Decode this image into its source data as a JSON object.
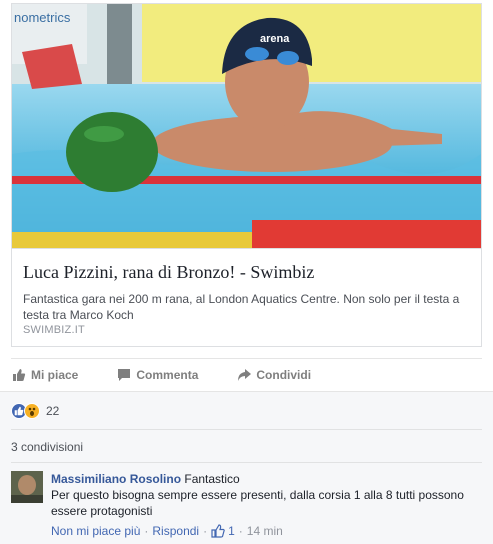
{
  "link_card": {
    "title": "Luca Pizzini, rana di Bronzo! - Swimbiz",
    "description": "Fantastica gara nei 200 m rana, al London Aquatics Centre. Non solo per il testa a testa tra Marco Koch",
    "domain": "SWIMBIZ.IT",
    "image_text": "nometrics",
    "cap_text": "arena"
  },
  "actions": {
    "like": "Mi piace",
    "comment": "Commenta",
    "share": "Condividi"
  },
  "reactions": {
    "types": [
      "like-icon",
      "wow-icon"
    ],
    "count": "22"
  },
  "shares": "3 condivisioni",
  "comment": {
    "author": "Massimiliano Rosolino",
    "text_first": "Fantastico",
    "text_rest": "Per questo bisogna sempre essere presenti, dalla corsia 1 alla 8 tutti possono essere protagonisti",
    "unlike": "Non mi piace più",
    "reply": "Rispondi",
    "likes": "1",
    "time": "14 min"
  },
  "colors": {
    "link_blue": "#365899",
    "action_gray": "#7f7f7f",
    "like_blue": "#4267b2",
    "wow_yellow": "#f7b125",
    "feedback_bg": "#f6f7f9"
  }
}
